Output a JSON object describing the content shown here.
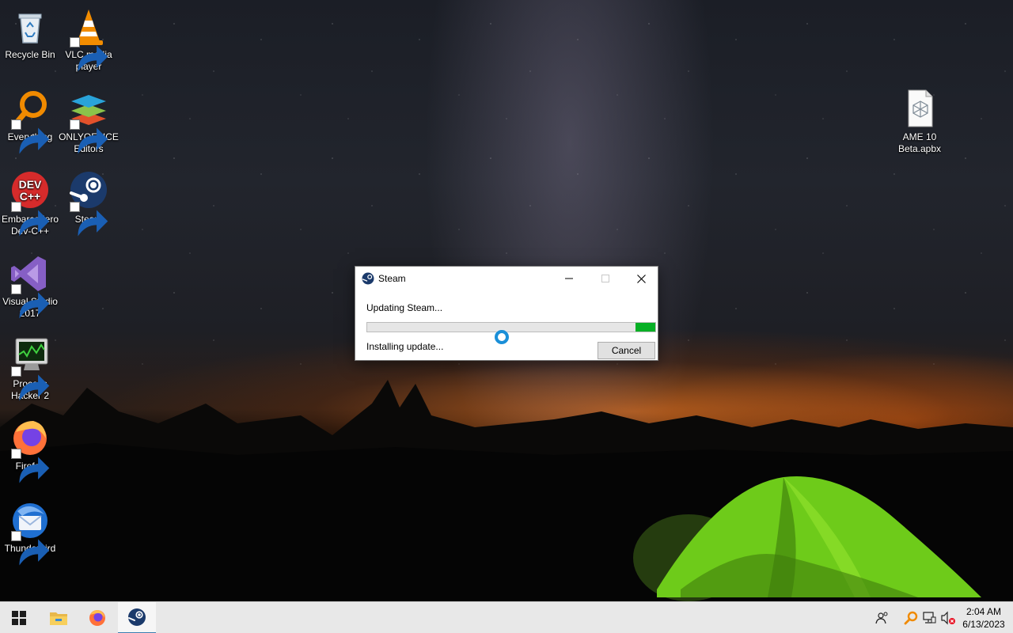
{
  "desktop": {
    "icons": [
      {
        "label": "Recycle Bin"
      },
      {
        "label": "VLC media player"
      },
      {
        "label": "Everything"
      },
      {
        "label": "ONLYOFFICE Editors"
      },
      {
        "label": "Embarcadero Dev-C++"
      },
      {
        "label": "Steam"
      },
      {
        "label": "Visual Studio 2017"
      },
      {
        "label": "Process Hacker 2"
      },
      {
        "label": "Firefox"
      },
      {
        "label": "Thunderbird"
      },
      {
        "label": "AME 10 Beta.apbx"
      }
    ],
    "devcpp_icon_text": [
      "DEV",
      "C++"
    ]
  },
  "dialog": {
    "title": "Steam",
    "status": "Updating Steam...",
    "substatus": "Installing update...",
    "cancel_label": "Cancel",
    "progress_percent": 7,
    "progress_style": "marquee"
  },
  "taskbar": {
    "apps": [
      "start-icon",
      "file-explorer-icon",
      "firefox-icon",
      "steam-icon"
    ],
    "active_app": "steam-icon",
    "tray": [
      "people-icon",
      "everything-icon",
      "network-icon",
      "volume-muted-icon"
    ],
    "time": "2:04 AM",
    "date": "6/13/2023"
  },
  "colors": {
    "progress_fill": "#06b025",
    "taskbar_bg": "#e8e8e8",
    "busy_cursor": "#1a8fd8"
  }
}
